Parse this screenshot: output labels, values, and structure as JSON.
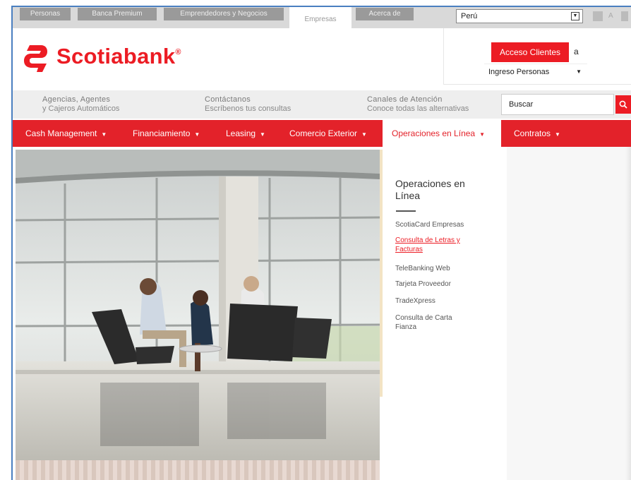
{
  "segments": [
    {
      "label": "Personas",
      "active": false
    },
    {
      "label": "Banca Premium",
      "active": false
    },
    {
      "label": "Emprendedores y Negocios",
      "active": false
    },
    {
      "label": "Empresas",
      "active": true
    },
    {
      "label": "Acerca de",
      "active": false
    }
  ],
  "country": {
    "value": "Perú"
  },
  "top_small": {
    "a_label": "A"
  },
  "brand": {
    "name": "Scotiabank",
    "mark": "®",
    "color": "#ec1c24"
  },
  "login": {
    "button_label": "Acceso Clientes",
    "suffix": "a",
    "selected": "Ingreso Personas"
  },
  "info": [
    {
      "title": "Agencias, Agentes",
      "sub": "y Cajeros Automáticos"
    },
    {
      "title": "Contáctanos",
      "sub": "Escríbenos tus consultas"
    },
    {
      "title": "Canales de Atención",
      "sub": "Conoce todas las alternativas"
    }
  ],
  "search": {
    "placeholder": "Buscar"
  },
  "nav": [
    {
      "label": "Cash Management",
      "active": false
    },
    {
      "label": "Financiamiento",
      "active": false
    },
    {
      "label": "Leasing",
      "active": false
    },
    {
      "label": "Comercio Exterior",
      "active": false
    },
    {
      "label": "Operaciones en Línea",
      "active": true
    },
    {
      "label": "Contratos",
      "active": false
    }
  ],
  "dropdown": {
    "title_line1": "Operaciones en",
    "title_line2": "Línea",
    "links": [
      {
        "line1": "ScotiaCard Empresas",
        "line2": "",
        "hot": false
      },
      {
        "line1": "Consulta de Letras y",
        "line2": "Facturas",
        "hot": true
      },
      {
        "line1": "TeleBanking Web",
        "line2": "",
        "hot": false
      },
      {
        "line1": "Tarjeta Proveedor",
        "line2": "",
        "hot": false
      },
      {
        "line1": "TradeXpress",
        "line2": "",
        "hot": false
      },
      {
        "line1": "Consulta de Carta",
        "line2": "Fianza",
        "hot": false
      }
    ]
  },
  "colors": {
    "brand_red": "#ec1c24",
    "nav_red": "#e3222a",
    "frame_blue": "#4a7fc0"
  },
  "icons": {
    "search": "search-icon",
    "logo": "scotiabank-s-logo-icon"
  }
}
